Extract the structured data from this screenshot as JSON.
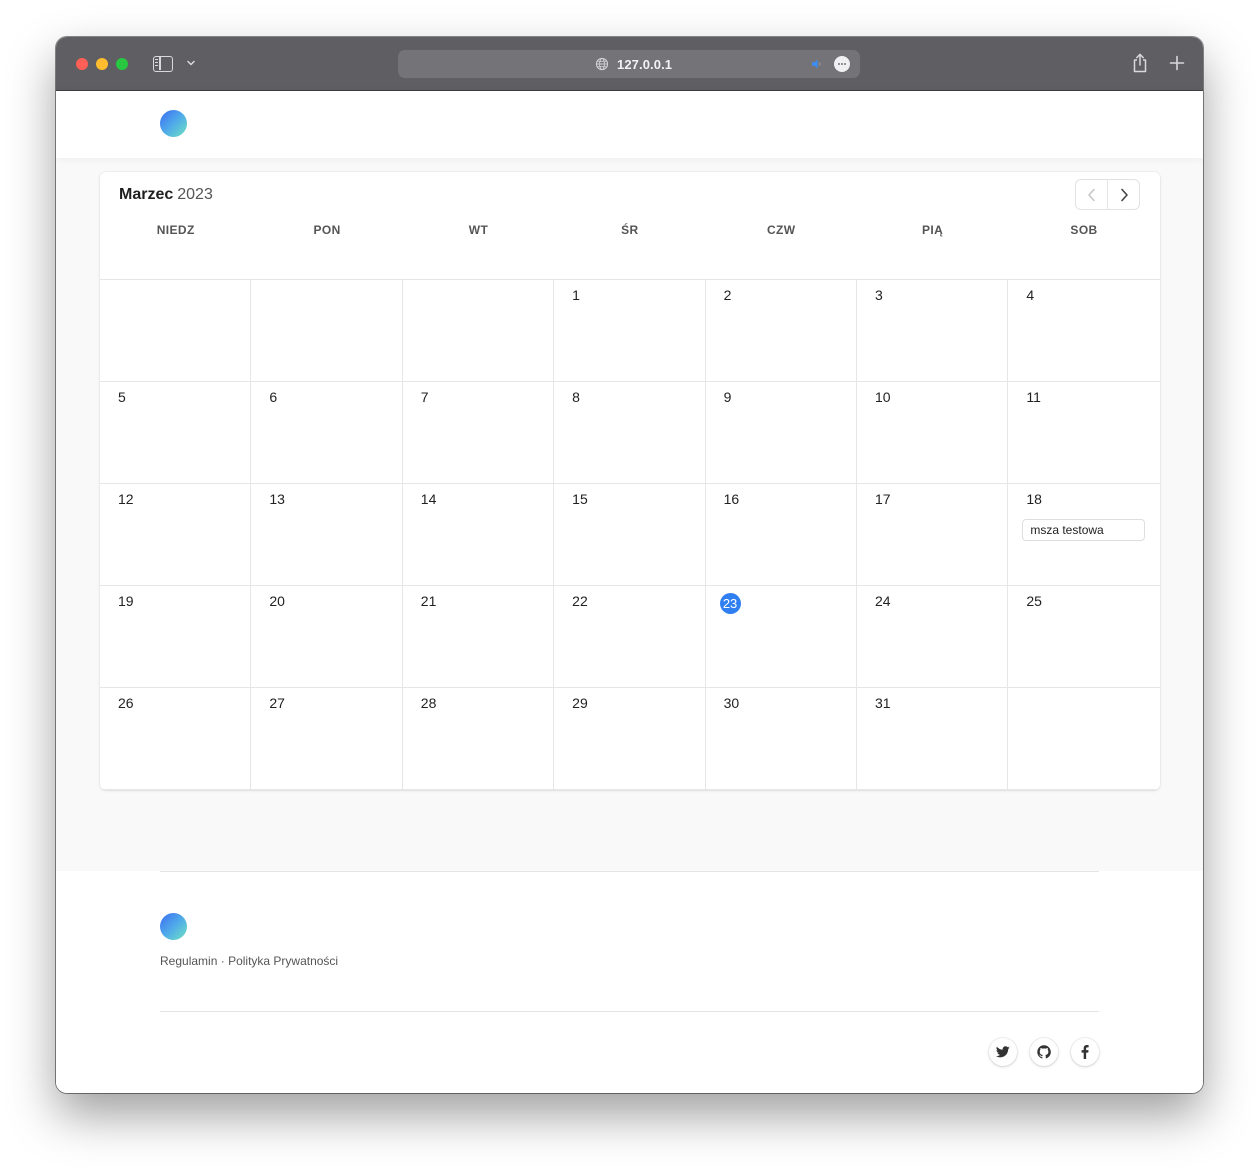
{
  "browser": {
    "url": "127.0.0.1"
  },
  "calendar": {
    "month": "Marzec",
    "year": "2023",
    "weekdays": [
      "NIEDZ",
      "PON",
      "WT",
      "ŚR",
      "CZW",
      "PIĄ",
      "SOB"
    ],
    "weeks": [
      [
        "",
        "",
        "",
        "1",
        "2",
        "3",
        "4"
      ],
      [
        "5",
        "6",
        "7",
        "8",
        "9",
        "10",
        "11"
      ],
      [
        "12",
        "13",
        "14",
        "15",
        "16",
        "17",
        "18"
      ],
      [
        "19",
        "20",
        "21",
        "22",
        "23",
        "24",
        "25"
      ],
      [
        "26",
        "27",
        "28",
        "29",
        "30",
        "31",
        ""
      ]
    ],
    "today": "23",
    "today_color": "#2f7ff0",
    "events": [
      {
        "day": "18",
        "title": "msza testowa"
      }
    ]
  },
  "footer": {
    "links": [
      {
        "label": "Regulamin"
      },
      {
        "label": "Polityka Prywatności"
      }
    ],
    "separator": "·",
    "social": [
      {
        "icon": "twitter-icon"
      },
      {
        "icon": "github-icon"
      },
      {
        "icon": "facebook-icon"
      }
    ]
  },
  "icons": {
    "prev": "chevron-left-icon",
    "next": "chevron-right-icon"
  }
}
